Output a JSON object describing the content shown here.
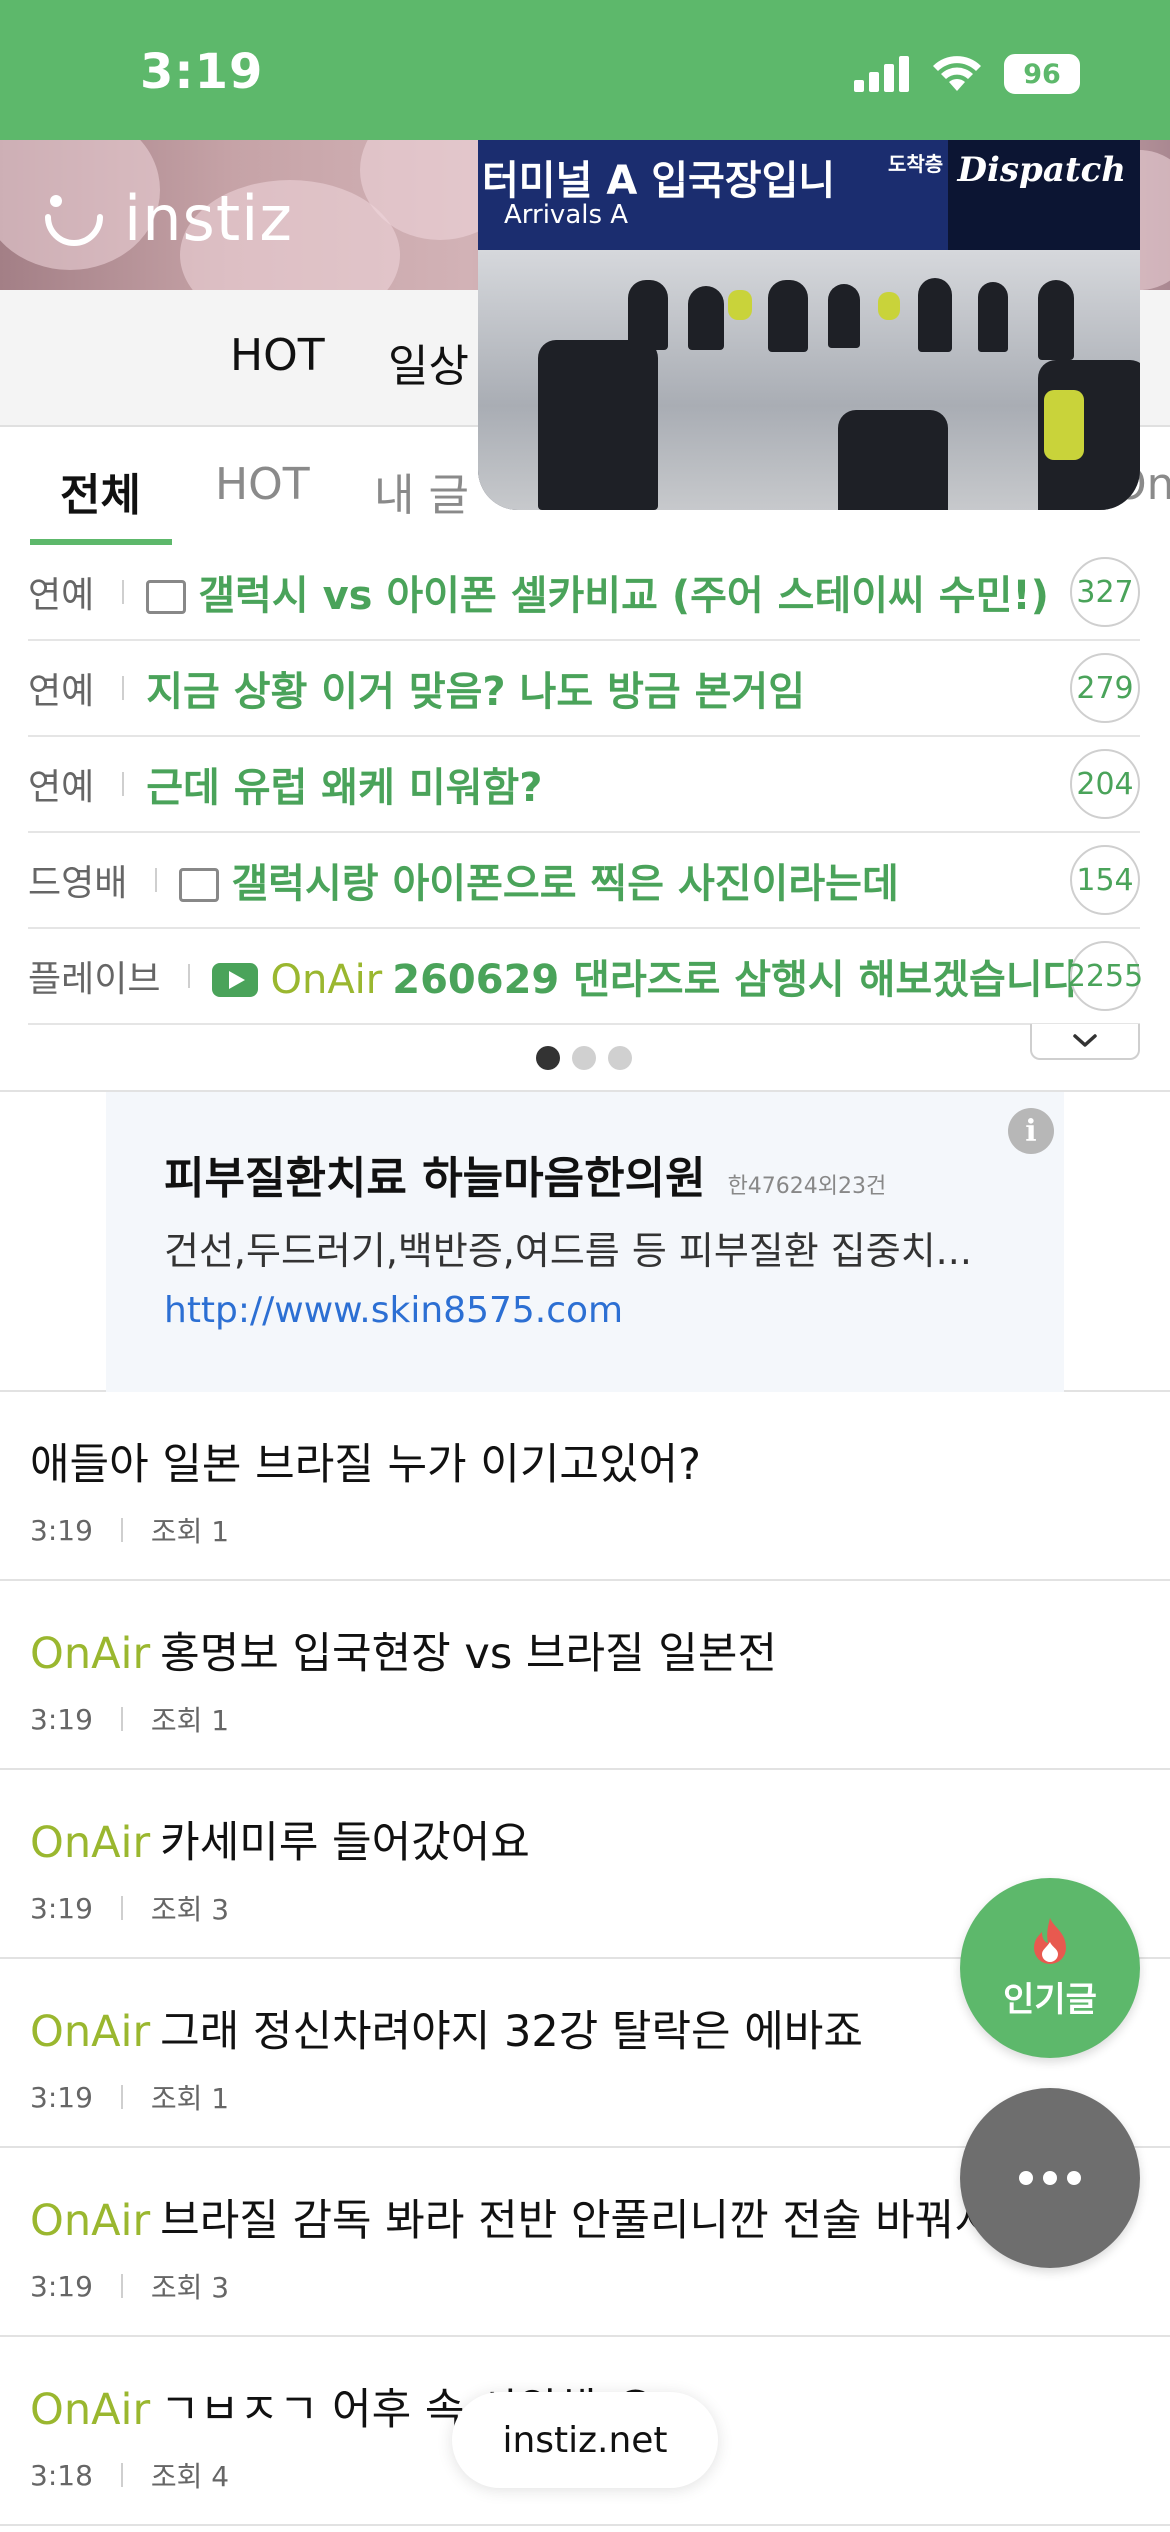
{
  "status_bar": {
    "time": "3:19",
    "battery": "96"
  },
  "header": {
    "logo_text": "instiz"
  },
  "category_nav": {
    "items": [
      "HOT",
      "일상"
    ]
  },
  "subtabs": {
    "items": [
      "전체",
      "HOT",
      "내 글"
    ],
    "trailing": "On"
  },
  "video": {
    "sign_text": "터미널 A 입국장입니",
    "sign_sub": "Arrivals A",
    "board_text": "도착층",
    "watermark": "Dispatch"
  },
  "hot_list": [
    {
      "category": "연예",
      "icon": "image-icon",
      "title": "갤럭시 vs 아이폰 셀카비교 (주어 스테이씨 수민!)",
      "count": "327"
    },
    {
      "category": "연예",
      "icon": "",
      "title": "지금 상황 이거 맞음? 나도 방금 본거임",
      "count": "279"
    },
    {
      "category": "연예",
      "icon": "",
      "title": "근데 유럽 왜케 미워함?",
      "count": "204"
    },
    {
      "category": "드영배",
      "icon": "image-icon",
      "title": "갤럭시랑 아이폰으로 찍은 사진이라는데",
      "count": "154"
    },
    {
      "category": "플레이브",
      "icon": "youtube-icon",
      "prefix": "OnAir",
      "title": "260629 댄라즈로 삼행시 해보겠습니다",
      "count": "2255"
    }
  ],
  "ad": {
    "title": "피부질환치료 하늘마음한의원",
    "meta": "한47624외23건",
    "description": "건선,두드러기,백반증,여드름 등 피부질환 집중치...",
    "url": "http://www.skin8575.com"
  },
  "posts": [
    {
      "prefix": "",
      "title": "애들아 일본 브라질 누가 이기고있어?",
      "time": "3:19",
      "views": "조회 1"
    },
    {
      "prefix": "OnAir",
      "title": "홍명보 입국현장 vs 브라질 일본전",
      "time": "3:19",
      "views": "조회 1"
    },
    {
      "prefix": "OnAir",
      "title": "카세미루 들어갔어요",
      "time": "3:19",
      "views": "조회 3"
    },
    {
      "prefix": "OnAir",
      "title": "그래 정신차려야지 32강 탈락은 에바죠",
      "time": "3:19",
      "views": "조회 1"
    },
    {
      "prefix": "OnAir",
      "title": "브라질 감독 봐라 전반 안풀리니깐 전술 바꿔서 나와",
      "time": "3:19",
      "views": "조회 3"
    },
    {
      "prefix": "OnAir",
      "title": "ㄱㅂㅈㄱ 어후 속 시원해 😂",
      "time": "3:18",
      "views": "조회 4"
    }
  ],
  "fab": {
    "hot_label": "인기글"
  },
  "browser": {
    "url": "instiz.net"
  },
  "colors": {
    "brand": "#5db86b",
    "onair": "#9ab72f",
    "link": "#2c6fd3"
  }
}
